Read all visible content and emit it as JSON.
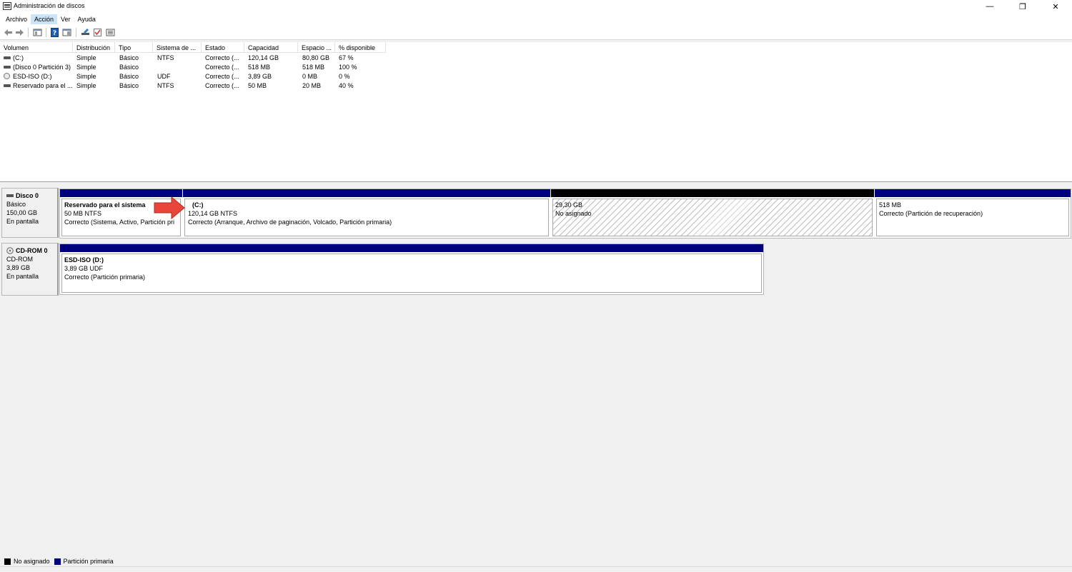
{
  "window": {
    "title": "Administración de discos",
    "minimize_glyph": "—",
    "restore_glyph": "❐",
    "close_glyph": "✕"
  },
  "menu": [
    {
      "label": "Archivo"
    },
    {
      "label": "Acción"
    },
    {
      "label": "Ver"
    },
    {
      "label": "Ayuda"
    }
  ],
  "toolbar": [
    "back-icon",
    "forward-icon",
    "console-tree-icon",
    "help-icon",
    "properties-icon",
    "disk-icon",
    "checklist-icon",
    "list-icon"
  ],
  "volume_list": {
    "columns": [
      "Volumen",
      "Distribución",
      "Tipo",
      "Sistema de ...",
      "Estado",
      "Capacidad",
      "Espacio ...",
      "% disponible"
    ],
    "rows": [
      {
        "icon": "volume-icon",
        "cells": [
          "(C:)",
          "Simple",
          "Básico",
          "NTFS",
          "Correcto (...",
          "120,14 GB",
          "80,80 GB",
          "67 %"
        ]
      },
      {
        "icon": "volume-icon",
        "cells": [
          "(Disco 0 Partición 3)",
          "Simple",
          "Básico",
          "",
          "Correcto (...",
          "518 MB",
          "518 MB",
          "100 %"
        ]
      },
      {
        "icon": "cdrom-icon",
        "cells": [
          "ESD-ISO (D:)",
          "Simple",
          "Básico",
          "UDF",
          "Correcto (...",
          "3,89 GB",
          "0 MB",
          "0 %"
        ]
      },
      {
        "icon": "volume-icon",
        "cells": [
          "Reservado para el ...",
          "Simple",
          "Básico",
          "NTFS",
          "Correcto (...",
          "50 MB",
          "20 MB",
          "40 %"
        ]
      }
    ]
  },
  "disks": [
    {
      "name": "Disco 0",
      "type": "Básico",
      "size": "150,00 GB",
      "status": "En pantalla",
      "partitions": [
        {
          "title": "Reservado para el sistema",
          "line1": "50 MB NTFS",
          "line2": "Correcto (Sistema, Activo, Partición pri",
          "kind": "primary"
        },
        {
          "title": "(C:)",
          "line1": "120,14 GB NTFS",
          "line2": "Correcto (Arranque, Archivo de paginación, Volcado, Partición primaria)",
          "kind": "primary"
        },
        {
          "title": "",
          "line1": "29,30 GB",
          "line2": "No asignado",
          "kind": "unallocated"
        },
        {
          "title": "",
          "line1": "518 MB",
          "line2": "Correcto (Partición de recuperación)",
          "kind": "primary"
        }
      ]
    },
    {
      "name": "CD-ROM 0",
      "type": "CD-ROM",
      "size": "3,89 GB",
      "status": "En pantalla",
      "partitions": [
        {
          "title": "ESD-ISO  (D:)",
          "line1": "3,89 GB UDF",
          "line2": "Correcto (Partición primaria)",
          "kind": "primary"
        }
      ]
    }
  ],
  "legend": [
    {
      "label": "No asignado",
      "color": "#000000"
    },
    {
      "label": "Partición primaria",
      "color": "#00007f"
    }
  ],
  "colors": {
    "primary": "#00007f",
    "unallocated": "#000000",
    "arrow": "#e8453c"
  }
}
